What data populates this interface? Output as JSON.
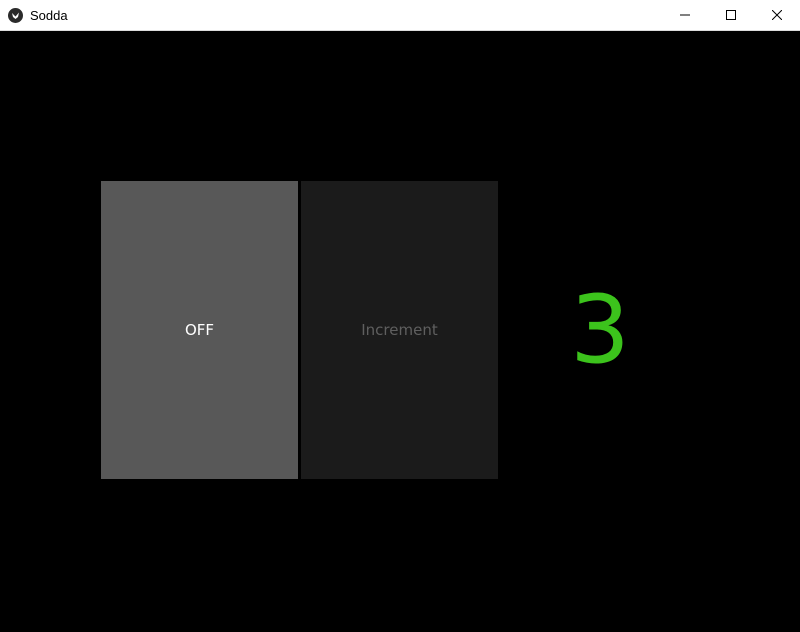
{
  "window": {
    "title": "Sodda",
    "icon": "kivy-app-icon",
    "controls": {
      "minimize_icon": "minimize-icon",
      "maximize_icon": "maximize-icon",
      "close_icon": "close-icon"
    }
  },
  "main": {
    "toggle_button_label": "OFF",
    "increment_button_label": "Increment",
    "counter_value": "3"
  },
  "colors": {
    "background": "#000000",
    "toggle_button_bg": "#585858",
    "increment_button_bg": "#1b1b1b",
    "increment_label": "#5f5f5f",
    "counter": "#3cc31c"
  }
}
